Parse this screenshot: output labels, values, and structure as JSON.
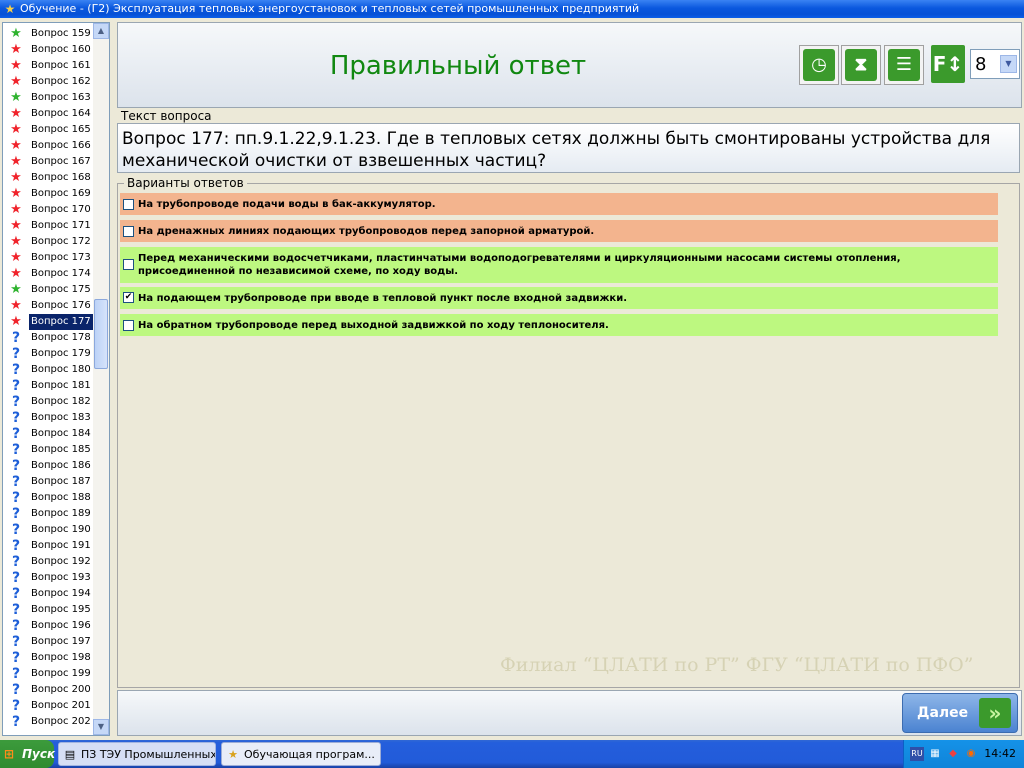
{
  "window": {
    "title": "Обучение - (Г2) Эксплуатация тепловых энергоустановок и тепловых сетей промышленных предприятий"
  },
  "sidebar": {
    "items": [
      {
        "label": "Вопрос 159",
        "status": "green"
      },
      {
        "label": "Вопрос 160",
        "status": "red"
      },
      {
        "label": "Вопрос 161",
        "status": "red"
      },
      {
        "label": "Вопрос 162",
        "status": "red"
      },
      {
        "label": "Вопрос 163",
        "status": "green"
      },
      {
        "label": "Вопрос 164",
        "status": "red"
      },
      {
        "label": "Вопрос 165",
        "status": "red"
      },
      {
        "label": "Вопрос 166",
        "status": "red"
      },
      {
        "label": "Вопрос 167",
        "status": "red"
      },
      {
        "label": "Вопрос 168",
        "status": "red"
      },
      {
        "label": "Вопрос 169",
        "status": "red"
      },
      {
        "label": "Вопрос 170",
        "status": "red"
      },
      {
        "label": "Вопрос 171",
        "status": "red"
      },
      {
        "label": "Вопрос 172",
        "status": "red"
      },
      {
        "label": "Вопрос 173",
        "status": "red"
      },
      {
        "label": "Вопрос 174",
        "status": "red"
      },
      {
        "label": "Вопрос 175",
        "status": "green"
      },
      {
        "label": "Вопрос 176",
        "status": "red"
      },
      {
        "label": "Вопрос 177",
        "status": "red",
        "selected": true
      },
      {
        "label": "Вопрос 178",
        "status": "unknown"
      },
      {
        "label": "Вопрос 179",
        "status": "unknown"
      },
      {
        "label": "Вопрос 180",
        "status": "unknown"
      },
      {
        "label": "Вопрос 181",
        "status": "unknown"
      },
      {
        "label": "Вопрос 182",
        "status": "unknown"
      },
      {
        "label": "Вопрос 183",
        "status": "unknown"
      },
      {
        "label": "Вопрос 184",
        "status": "unknown"
      },
      {
        "label": "Вопрос 185",
        "status": "unknown"
      },
      {
        "label": "Вопрос 186",
        "status": "unknown"
      },
      {
        "label": "Вопрос 187",
        "status": "unknown"
      },
      {
        "label": "Вопрос 188",
        "status": "unknown"
      },
      {
        "label": "Вопрос 189",
        "status": "unknown"
      },
      {
        "label": "Вопрос 190",
        "status": "unknown"
      },
      {
        "label": "Вопрос 191",
        "status": "unknown"
      },
      {
        "label": "Вопрос 192",
        "status": "unknown"
      },
      {
        "label": "Вопрос 193",
        "status": "unknown"
      },
      {
        "label": "Вопрос 194",
        "status": "unknown"
      },
      {
        "label": "Вопрос 195",
        "status": "unknown"
      },
      {
        "label": "Вопрос 196",
        "status": "unknown"
      },
      {
        "label": "Вопрос 197",
        "status": "unknown"
      },
      {
        "label": "Вопрос 198",
        "status": "unknown"
      },
      {
        "label": "Вопрос 199",
        "status": "unknown"
      },
      {
        "label": "Вопрос 200",
        "status": "unknown"
      },
      {
        "label": "Вопрос 201",
        "status": "unknown"
      },
      {
        "label": "Вопрос 202",
        "status": "unknown"
      }
    ],
    "status_icons": {
      "green": "green-star-icon",
      "red": "red-star-icon",
      "unknown": "question-mark-icon"
    }
  },
  "header": {
    "title": "Правильный ответ",
    "toolbar": {
      "icons": [
        "clock-icon",
        "hourglass-icon",
        "list-icon",
        "font-size-icon"
      ],
      "font_size_value": "8"
    }
  },
  "question": {
    "label": "Текст вопроса",
    "text": "Вопрос 177: пп.9.1.22,9.1.23. Где в тепловых сетях должны быть смонтированы устройства для механической очистки от взвешенных частиц?"
  },
  "answers": {
    "legend": "Варианты ответов",
    "items": [
      {
        "text": "На трубопроводе подачи воды в бак-аккумулятор.",
        "checked": false,
        "correct": false
      },
      {
        "text": "На дренажных линиях подающих трубопроводов перед запорной арматурой.",
        "checked": false,
        "correct": false
      },
      {
        "text": "Перед механическими водосчетчиками, пластинчатыми водоподогревателями и циркуляционными насосами системы отопления, присоединенной по независимой схеме, по ходу воды.",
        "checked": false,
        "correct": true
      },
      {
        "text": "На подающем трубопроводе при вводе в тепловой пункт после входной задвижки.",
        "checked": true,
        "correct": true
      },
      {
        "text": "На обратном трубопроводе перед выходной задвижкой по ходу теплоносителя.",
        "checked": false,
        "correct": true
      }
    ],
    "colors": {
      "wrong": "#F3B48E",
      "correct": "#BDF880"
    }
  },
  "watermark": "Филиал “ЦЛАТИ по РТ” ФГУ “ЦЛАТИ по ПФО”",
  "footer": {
    "next_label": "Далее"
  },
  "taskbar": {
    "start_label": "Пуск",
    "tasks": [
      {
        "label": "ПЗ ТЭУ Промышленных...",
        "icon": "document-icon"
      },
      {
        "label": "Обучающая програм...",
        "icon": "app-icon"
      }
    ],
    "tray": {
      "lang": "RU",
      "clock": "14:42"
    }
  }
}
